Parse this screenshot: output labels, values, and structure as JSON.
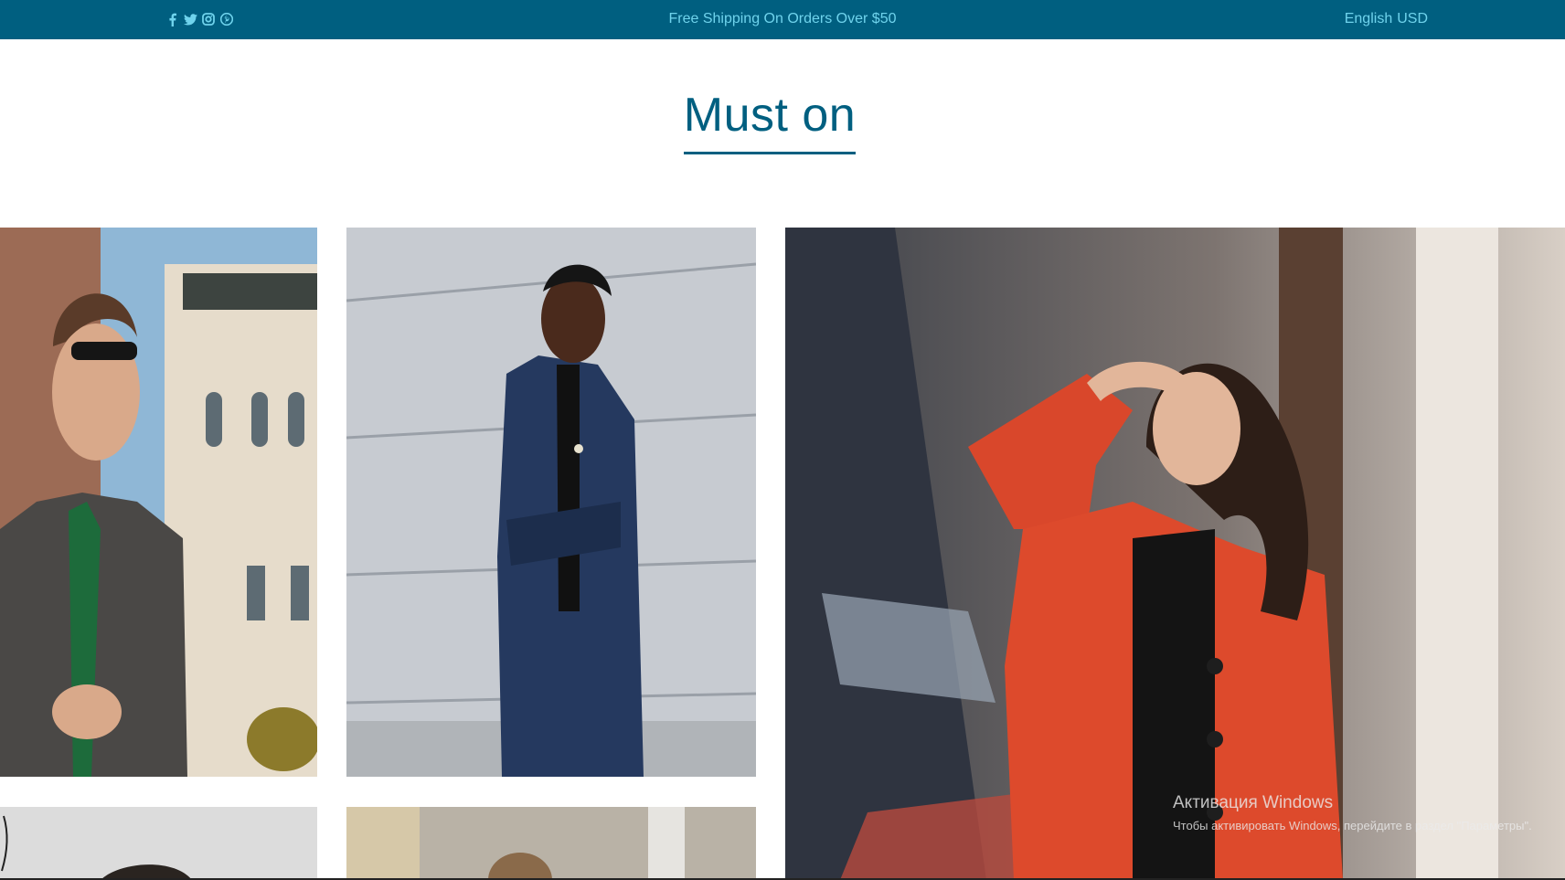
{
  "topbar": {
    "social_icons": [
      "facebook-icon",
      "twitter-icon",
      "instagram-icon",
      "pinterest-icon"
    ],
    "promo_text": "Free Shipping On Orders Over $50",
    "language": "English",
    "currency": "USD"
  },
  "section": {
    "title": "Must on"
  },
  "gallery": [
    {
      "subject": "man in sunglasses and grey blazer"
    },
    {
      "subject": "man in navy blazer leaning on wall"
    },
    {
      "subject": "woman in red coat"
    },
    {
      "subject": "partial photo"
    },
    {
      "subject": "partial photo"
    }
  ],
  "watermark": {
    "title": "Активация Windows",
    "subtitle": "Чтобы активировать Windows, перейдите в раздел \"Параметры\"."
  },
  "colors": {
    "topbar_bg": "#005f80",
    "topbar_text": "#6fd3ec",
    "title": "#005f80"
  }
}
